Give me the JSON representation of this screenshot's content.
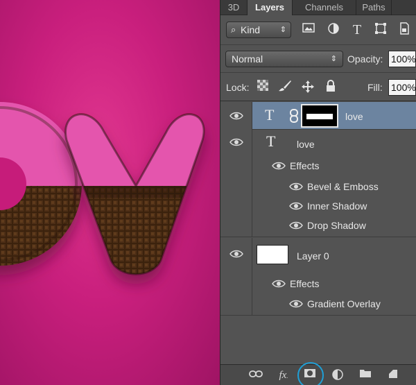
{
  "canvas": {
    "colors": {
      "background": "#c91f7d",
      "letters_top": "#e455ad",
      "chocolate": "#3b2210"
    }
  },
  "panel": {
    "tabs": [
      "3D",
      "Layers",
      "Channels",
      "Paths"
    ],
    "filter": {
      "kind_label": "Kind",
      "search_icon": "search-icon",
      "kind_arrows_icon": "updown-arrows-icon"
    },
    "blend_mode": "Normal",
    "opacity_label": "Opacity:",
    "opacity_value": "100%",
    "lock_label": "Lock:",
    "fill_label": "Fill:",
    "fill_value": "100%",
    "layers": [
      {
        "name": "love",
        "type": "text-with-mask",
        "selected": true
      },
      {
        "name": "love",
        "type": "text",
        "effects_label": "Effects",
        "effects": [
          "Bevel & Emboss",
          "Inner Shadow",
          "Drop Shadow"
        ]
      },
      {
        "name": "Layer 0",
        "type": "pixel",
        "effects_label": "Effects",
        "effects": [
          "Gradient Overlay"
        ]
      }
    ],
    "colors": {
      "selected_row": "#6c84a0",
      "highlight_ring": "#1f9fd6"
    }
  }
}
